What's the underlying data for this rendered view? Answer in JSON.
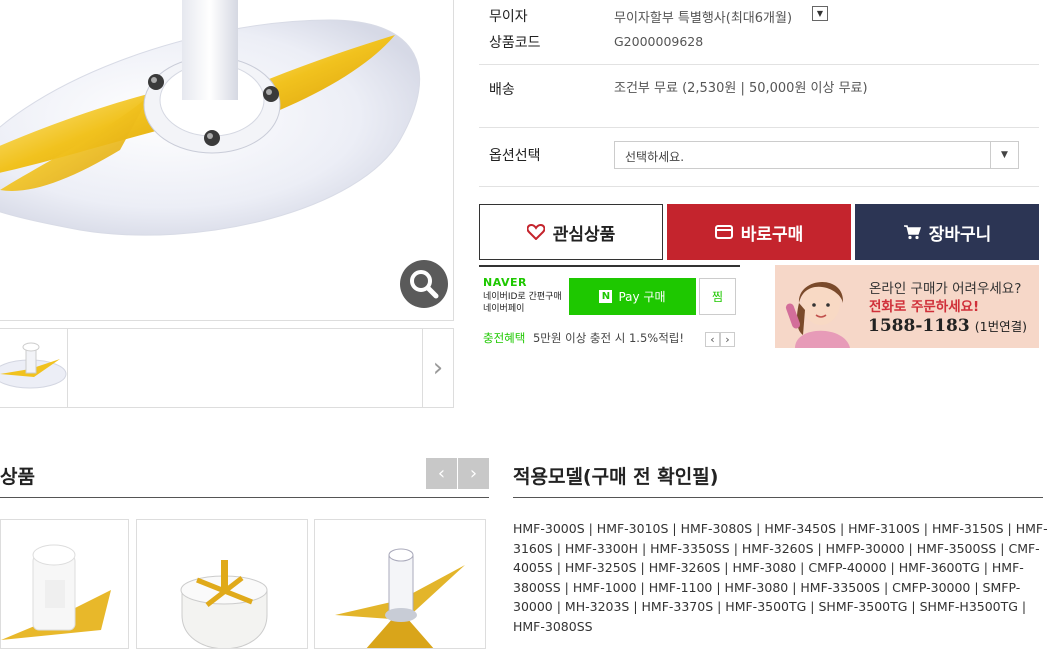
{
  "info": {
    "interest_free_label": "무이자",
    "interest_free_value": "무이자할부 특별행사(최대6개월)",
    "product_code_label": "상품코드",
    "product_code_value": "G2000009628",
    "shipping_label": "배송",
    "shipping_value": "조건부 무료 (2,530원 | 50,000원 이상 무료)",
    "option_label": "옵션선택",
    "option_selected": "선택하세요."
  },
  "buttons": {
    "wish": "관심상품",
    "buy": "바로구매",
    "cart": "장바구니"
  },
  "npay": {
    "brand": "NAVER",
    "line1": "네이버ID로 간편구매",
    "line2": "네이버페이",
    "buy_label": "Pay 구매",
    "zzim_label": "찜",
    "benefit_tag": "충전혜택",
    "benefit_text": "5만원 이상 충전 시 1.5%적립!"
  },
  "phone_banner": {
    "line1": "온라인 구매가 어려우세요?",
    "line2": "전화로 주문하세요!",
    "phone": "1588-1183",
    "ext": "(1번연결)"
  },
  "related": {
    "title": "상품"
  },
  "models": {
    "title": "적용모델(구매 전 확인필)",
    "text": "HMF-3000S | HMF-3010S | HMF-3080S | HMF-3450S | HMF-3100S | HMF-3150S | HMF-3160S | HMF-3300H | HMF-3350SS | HMF-3260S | HMFP-30000 | HMF-3500SS | CMF-4005S | HMF-3250S | HMF-3260S | HMF-3080 | CMFP-40000 | HMF-3600TG | HMF-3800SS | HMF-1000 | HMF-1100 | HMF-3080 | HMF-33500S | CMFP-30000 | SMFP-30000 | MH-3203S | HMF-3370S | HMF-3500TG | SHMF-3500TG | SHMF-H3500TG | HMF-3080SS"
  },
  "colors": {
    "buy": "#c4242d",
    "cart": "#2c3554",
    "naver_green": "#1ec800"
  }
}
